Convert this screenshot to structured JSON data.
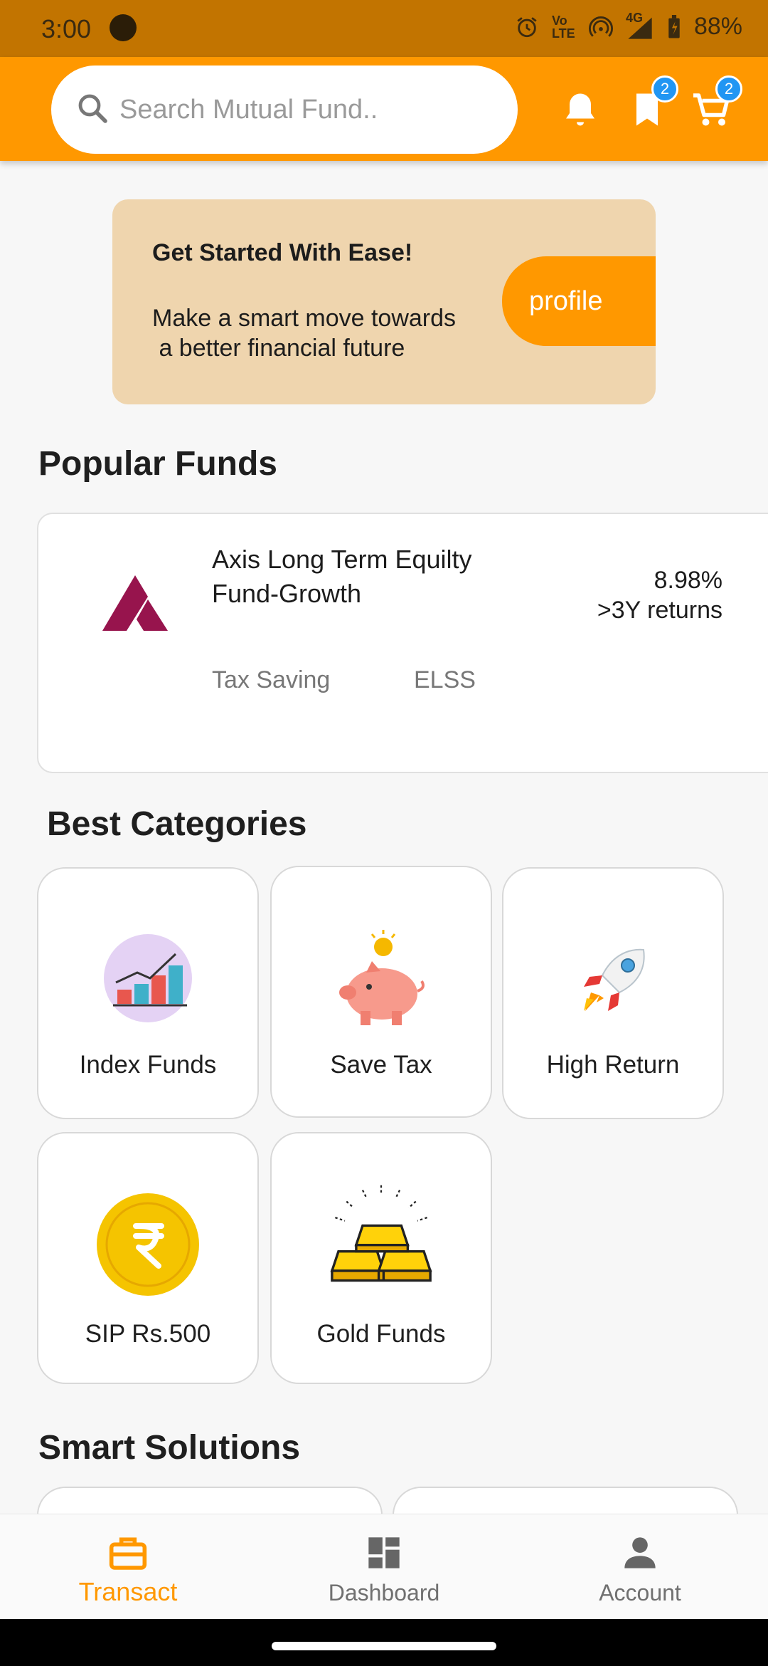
{
  "status_bar": {
    "time": "3:00",
    "net_label": "Vo LTE",
    "signal_label": "4G",
    "battery": "88%"
  },
  "header": {
    "search_placeholder": "Search Mutual Fund..",
    "bookmark_count": "2",
    "cart_count": "2"
  },
  "banner": {
    "title": "Get Started With Ease!",
    "line1": "Make a smart move towards",
    "line2": " a better financial future",
    "button_label": "profile"
  },
  "popular": {
    "title": "Popular Funds",
    "fund": {
      "name": "Axis Long Term Equilty Fund-Growth",
      "return_value": "8.98%",
      "return_period": ">3Y returns",
      "tag1": "Tax Saving",
      "tag2": "ELSS"
    }
  },
  "categories": {
    "title": "Best Categories",
    "items": [
      {
        "label": "Index Funds",
        "icon": "chart-icon"
      },
      {
        "label": "Save Tax",
        "icon": "piggy-bank-icon"
      },
      {
        "label": "High Return",
        "icon": "rocket-icon"
      },
      {
        "label": "SIP Rs.500",
        "icon": "rupee-coin-icon"
      },
      {
        "label": "Gold Funds",
        "icon": "gold-bars-icon"
      }
    ]
  },
  "solutions": {
    "title": "Smart Solutions"
  },
  "bottom_nav": {
    "items": [
      {
        "label": "Transact",
        "active": true
      },
      {
        "label": "Dashboard",
        "active": false
      },
      {
        "label": "Account",
        "active": false
      }
    ]
  },
  "colors": {
    "accent": "#ff9800",
    "status_bar": "#c27400",
    "banner_bg": "#efd5ae",
    "badge": "#2196f3",
    "axis_logo": "#97144d"
  }
}
